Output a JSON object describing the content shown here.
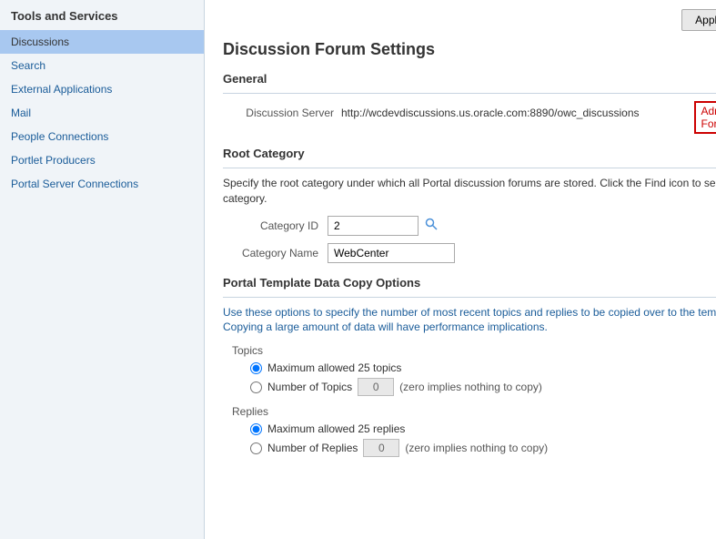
{
  "sidebar": {
    "title": "Tools and Services",
    "items": [
      {
        "id": "discussions",
        "label": "Discussions",
        "active": true
      },
      {
        "id": "search",
        "label": "Search"
      },
      {
        "id": "external-applications",
        "label": "External Applications"
      },
      {
        "id": "mail",
        "label": "Mail"
      },
      {
        "id": "people-connections",
        "label": "People Connections"
      },
      {
        "id": "portlet-producers",
        "label": "Portlet Producers"
      },
      {
        "id": "portal-server-connections",
        "label": "Portal Server Connections"
      }
    ]
  },
  "header": {
    "apply_label": "Apply",
    "help_icon": "?"
  },
  "page_title": "Discussion Forum Settings",
  "general": {
    "section_title": "General",
    "discussion_server_label": "Discussion Server",
    "discussion_server_value": "http://wcdevdiscussions.us.oracle.com:8890/owc_discussions",
    "admin_forums_label": "Administer Forums"
  },
  "root_category": {
    "section_title": "Root Category",
    "description": "Specify the root category under which all Portal discussion forums are stored. Click the Find icon to select a category.",
    "category_id_label": "Category ID",
    "category_id_value": "2",
    "category_name_label": "Category Name",
    "category_name_value": "WebCenter"
  },
  "template_data": {
    "section_title": "Portal Template Data Copy Options",
    "description": "Use these options to specify the number of most recent topics and replies to be copied over to the template. Copying a large amount of data will have performance implications.",
    "topics_label": "Topics",
    "max_topics_label": "Maximum allowed 25 topics",
    "num_topics_label": "Number of Topics",
    "num_topics_value": "0",
    "num_topics_note": "(zero implies nothing to copy)",
    "replies_label": "Replies",
    "max_replies_label": "Maximum allowed 25 replies",
    "num_replies_label": "Number of Replies",
    "num_replies_value": "0",
    "num_replies_note": "(zero implies nothing to copy)"
  }
}
